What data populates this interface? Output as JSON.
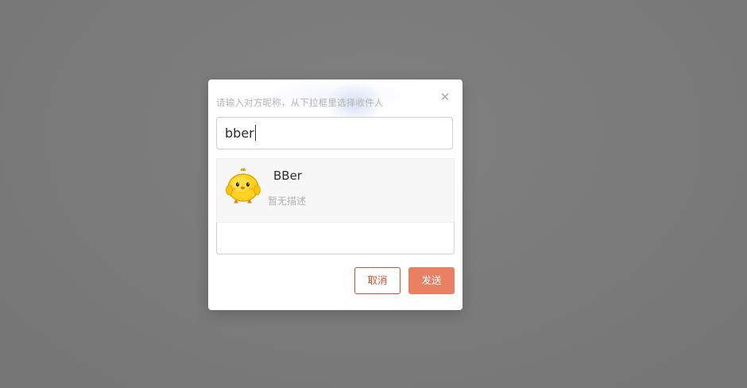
{
  "dialog": {
    "hint": "请输入对方昵称，从下拉框里选择收件人",
    "close_symbol": "✕",
    "recipient_input": {
      "value": "bber"
    },
    "suggestions": [
      {
        "name": "BBer",
        "description": "暂无描述",
        "avatar": "chick-avatar"
      }
    ],
    "message_textarea": {
      "value": ""
    },
    "buttons": {
      "cancel_label": "取消",
      "send_label": "发送"
    }
  },
  "colors": {
    "overlay": "#7a7a7a",
    "accent": "#d0512f",
    "send_button": "#ea8063",
    "dropdown_bg": "#f7f7f7"
  }
}
